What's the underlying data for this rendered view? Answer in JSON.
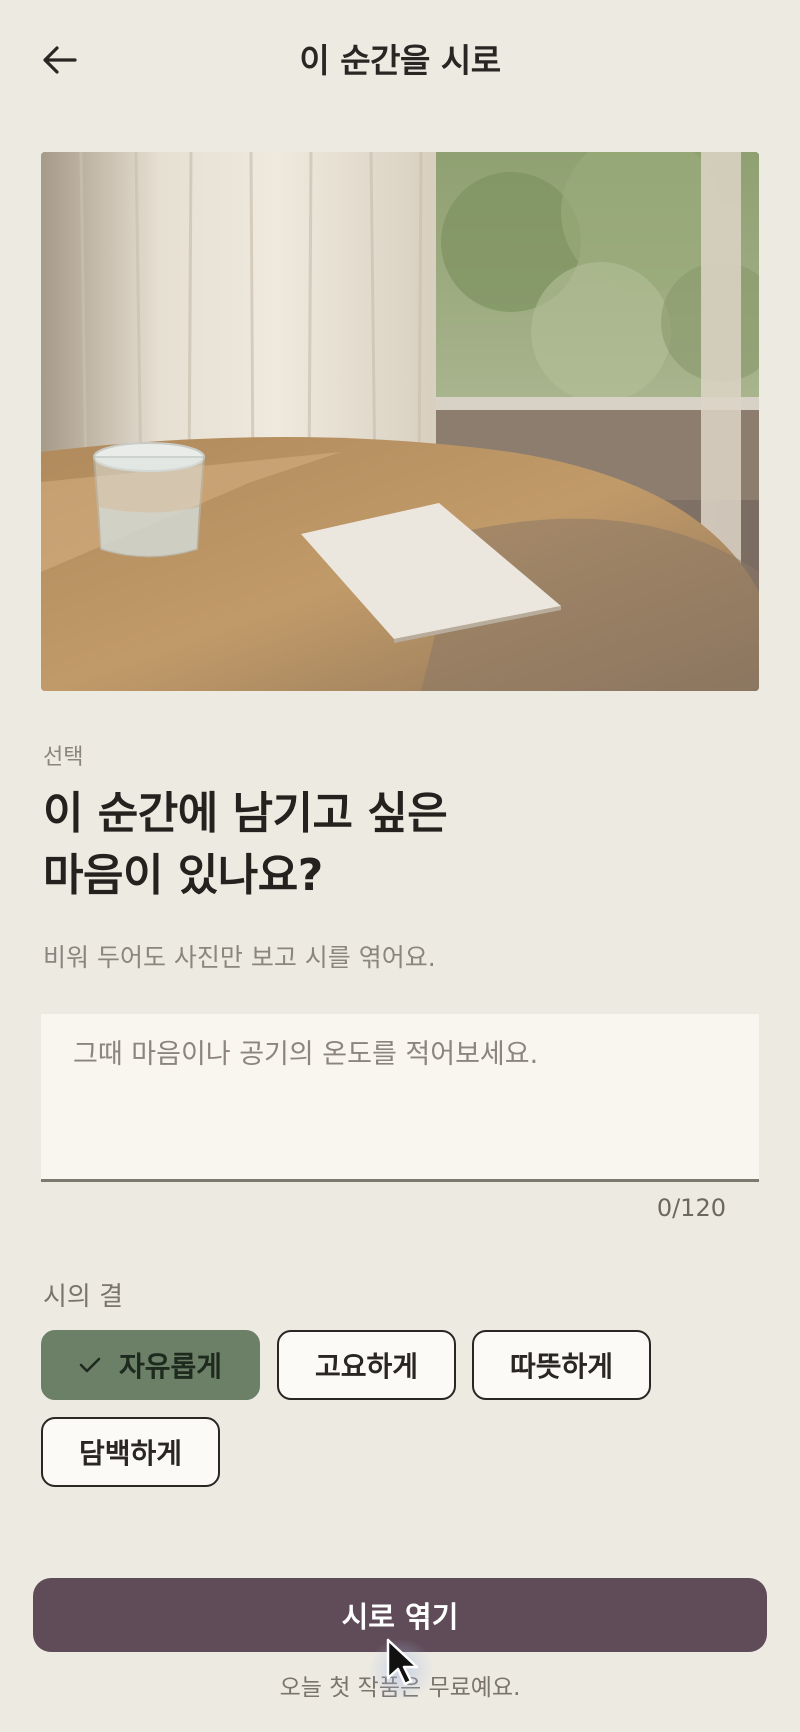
{
  "header": {
    "title": "이 순간을 시로",
    "back_icon": "arrow-left-icon"
  },
  "photo": {
    "subject": "desk-photo"
  },
  "form": {
    "optional_label": "선택",
    "prompt_line1": "이 순간에 남기고 싶은",
    "prompt_line2": "마음이 있나요?",
    "helper": "비워 두어도 사진만 보고 시를 엮어요.",
    "placeholder": "그때 마음이나 공기의 온도를 적어보세요.",
    "value": "",
    "counter": "0/120"
  },
  "tone": {
    "label": "시의 결",
    "options": [
      {
        "label": "자유롭게",
        "selected": true
      },
      {
        "label": "고요하게",
        "selected": false
      },
      {
        "label": "따뜻하게",
        "selected": false
      },
      {
        "label": "담백하게",
        "selected": false
      }
    ]
  },
  "cta": {
    "label": "시로 엮기",
    "note": "오늘 첫 작품은 무료예요."
  },
  "colors": {
    "background": "#edeae2",
    "accent_selected": "#6c7f67",
    "cta": "#5f4c58"
  }
}
